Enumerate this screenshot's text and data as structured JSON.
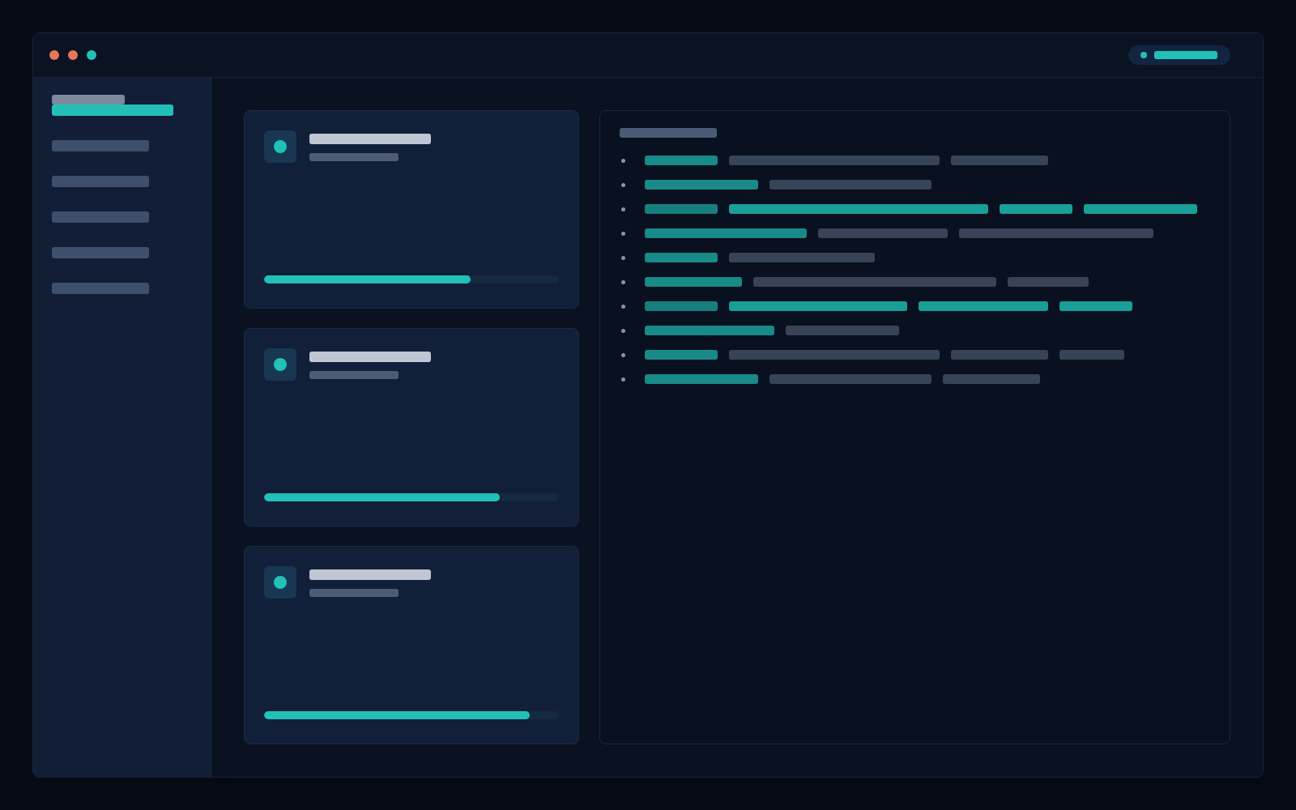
{
  "window": {
    "controls": [
      {
        "color": "#e8775a"
      },
      {
        "color": "#e8775a"
      },
      {
        "color": "#21c1b7"
      }
    ]
  },
  "sidebar": {
    "items": [
      {
        "selected": true
      },
      {
        "selected": false
      },
      {
        "selected": false
      },
      {
        "selected": false
      },
      {
        "selected": false
      },
      {
        "selected": false
      }
    ]
  },
  "cards": [
    {
      "level": 0.7
    },
    {
      "level": 0.8
    },
    {
      "level": 0.9
    }
  ],
  "panel": {
    "rows": [
      {
        "segments": [
          {
            "kind": "key"
          },
          {
            "kind": "muted"
          },
          {
            "kind": "muted"
          }
        ]
      },
      {
        "segments": [
          {
            "kind": "key"
          },
          {
            "kind": "muted"
          }
        ]
      },
      {
        "segments": [
          {
            "kind": "dim"
          },
          {
            "kind": "accent"
          },
          {
            "kind": "accent"
          },
          {
            "kind": "accent"
          }
        ]
      },
      {
        "segments": [
          {
            "kind": "key"
          },
          {
            "kind": "muted"
          },
          {
            "kind": "muted"
          }
        ]
      },
      {
        "segments": [
          {
            "kind": "key"
          },
          {
            "kind": "muted"
          }
        ]
      },
      {
        "segments": [
          {
            "kind": "key"
          },
          {
            "kind": "muted"
          },
          {
            "kind": "muted"
          }
        ]
      },
      {
        "segments": [
          {
            "kind": "dim"
          },
          {
            "kind": "accent"
          },
          {
            "kind": "accent"
          },
          {
            "kind": "accent"
          }
        ]
      },
      {
        "segments": [
          {
            "kind": "key"
          },
          {
            "kind": "muted"
          }
        ]
      },
      {
        "segments": [
          {
            "kind": "key"
          },
          {
            "kind": "muted"
          },
          {
            "kind": "muted"
          },
          {
            "kind": "muted"
          }
        ]
      },
      {
        "segments": [
          {
            "kind": "key"
          },
          {
            "kind": "muted"
          },
          {
            "kind": "muted"
          }
        ]
      }
    ]
  }
}
